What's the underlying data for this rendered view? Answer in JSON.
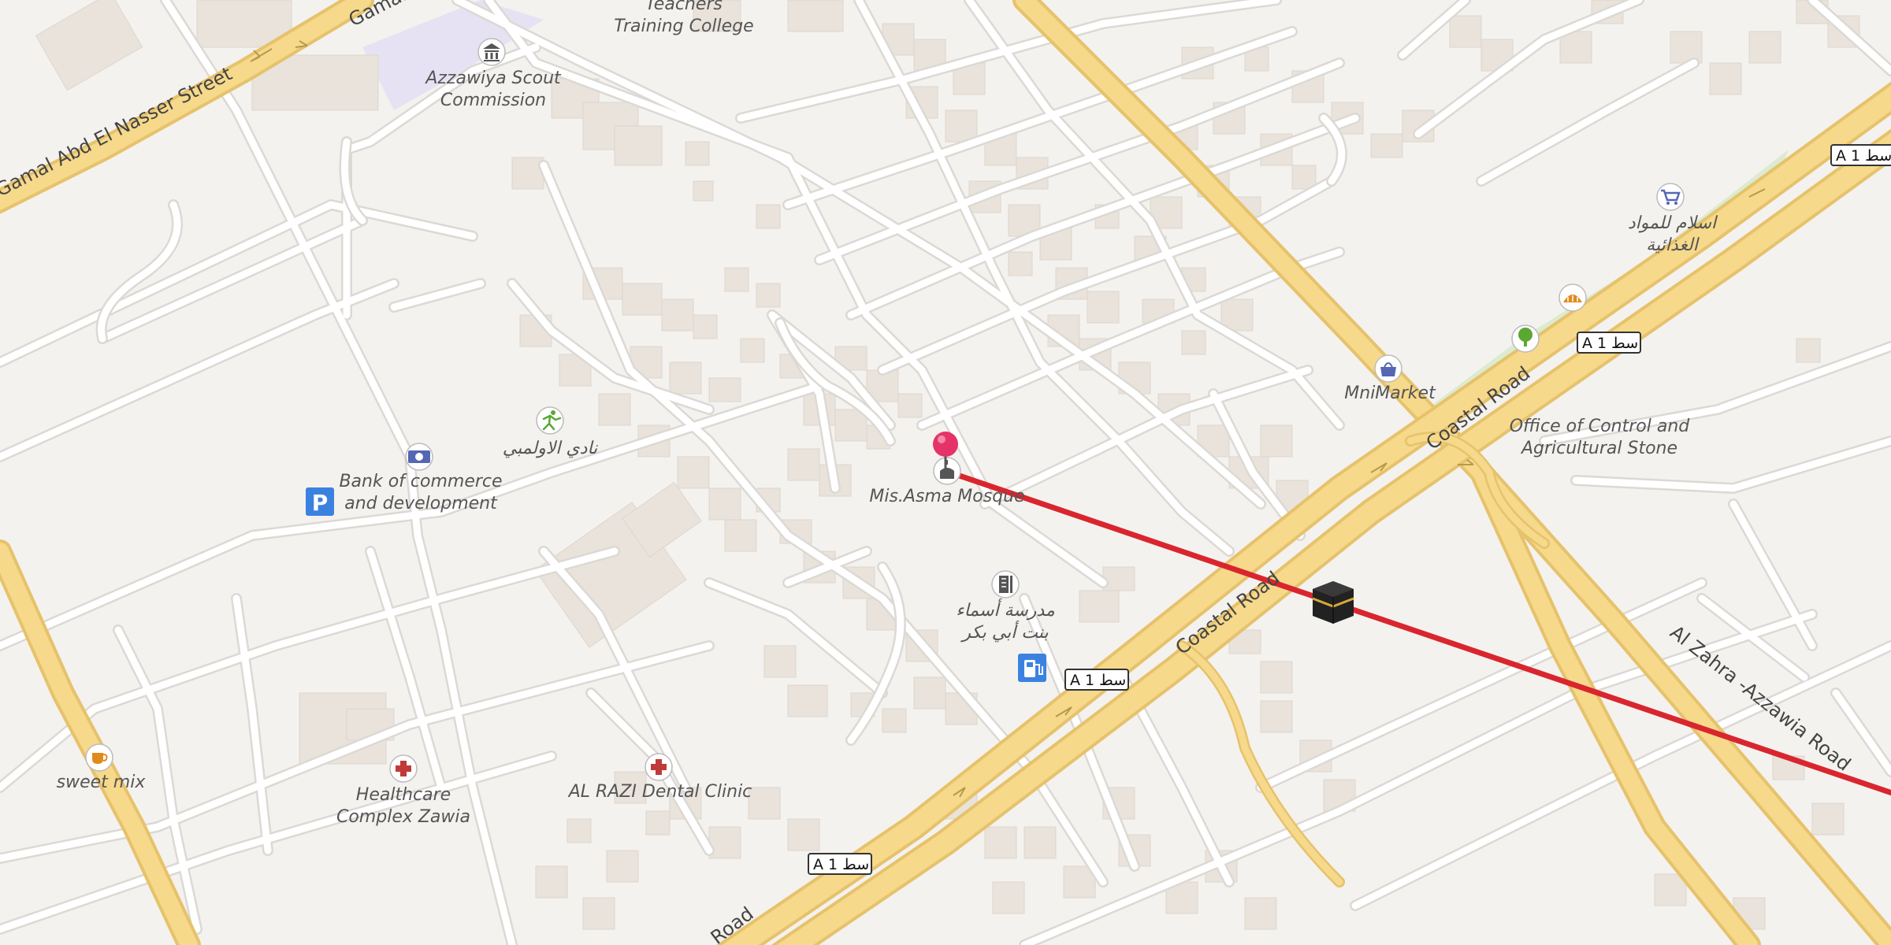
{
  "map": {
    "colors": {
      "background": "#f4f2ef",
      "minor_road": "#ffffff",
      "minor_road_casing": "#dcd9d4",
      "major_road": "#f6d98a",
      "major_road_casing": "#e6c26c",
      "building": "#e9e3dc",
      "park": "#dcebd0",
      "institution": "#e6e2f3",
      "route_line": "#d9262e",
      "pin": "#e5336a"
    },
    "street_labels": {
      "gamal_full": "Gamal Abd El Nasser Street",
      "gamal_cut": "Gamal",
      "coastal_1": "Coastal Road",
      "coastal_2": "Coastal Road",
      "coastal_3": "Road",
      "al_zahra": "Al Zahra -Azzawia Road"
    },
    "shields": {
      "a1_1": "A 1 سط",
      "a1_2": "A 1 سط",
      "a1_3": "A 1 سط",
      "a1_4": "A 1 سط"
    },
    "pois": {
      "teachers_college": {
        "line1": "Teachers",
        "line2": "Training College"
      },
      "scout": {
        "line1": "Azzawiya Scout",
        "line2": "Commission",
        "icon": "museum-icon"
      },
      "olympic_club": {
        "label": "نادي الاولمبي",
        "icon": "sport-icon"
      },
      "bank": {
        "line1": "Bank of commerce",
        "line2": "and development",
        "icon": "bank-icon"
      },
      "parking": {
        "label": "P",
        "icon": "parking-icon"
      },
      "mosque": {
        "label": "Mis.Asma Mosque",
        "icon": "mosque-icon"
      },
      "school": {
        "line1": "مدرسة أسماء",
        "line2": "بنت أبي بكر",
        "icon": "school-icon"
      },
      "fuel": {
        "icon": "fuel-icon"
      },
      "mnimarket": {
        "label": "MniMarket",
        "icon": "shopping-bag-icon"
      },
      "grocery": {
        "line1": "اسلام للمواد",
        "line2": "الغذائية",
        "icon": "shopping-cart-icon"
      },
      "bakery": {
        "icon": "bakery-icon"
      },
      "park_tree": {
        "icon": "tree-icon"
      },
      "office_control": {
        "line1": "Office of Control and",
        "line2": "Agricultural Stone"
      },
      "kaaba": {
        "icon": "kaaba-icon"
      },
      "sweet_mix": {
        "label": "sweet mix",
        "icon": "cafe-icon"
      },
      "healthcare": {
        "line1": "Healthcare",
        "line2": "Complex Zawia",
        "icon": "medical-cross-icon"
      },
      "dental": {
        "label": "AL RAZI Dental Clinic",
        "icon": "medical-cross-icon"
      }
    }
  }
}
